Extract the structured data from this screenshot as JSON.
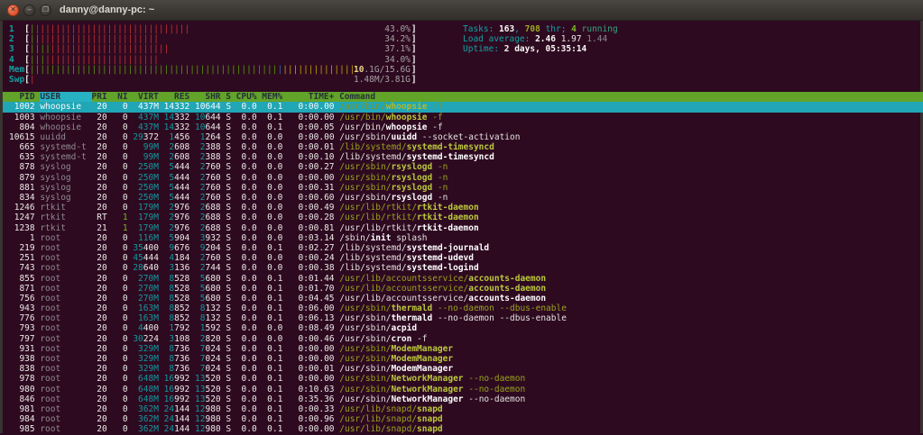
{
  "window": {
    "title": "danny@danny-pc: ~",
    "close_glyph": "✕",
    "minimize_glyph": "–",
    "maximize_glyph": "❐"
  },
  "colors": {
    "terminal_bg": "#2e0a21",
    "titlebar_bg": "#3a3733",
    "header_row_bg": "#62a32a",
    "selected_row_bg": "#21a6b6",
    "sort_column_bg": "#27b2c4",
    "label_cyan": "#12a1a1",
    "shadow_gray": "#8f8a90",
    "thread_command": "#99a31c",
    "bar_green": "#55980a",
    "bar_red": "#c53232",
    "bar_yellow": "#bfa000",
    "bar_blue": "#3566a4"
  },
  "meters": {
    "cpus": [
      {
        "label": "1",
        "pct": "43.0%",
        "green": 1,
        "red": 30
      },
      {
        "label": "2",
        "pct": "34.2%",
        "green": 2,
        "red": 23
      },
      {
        "label": "3",
        "pct": "37.1%",
        "green": 4,
        "red": 23
      },
      {
        "label": "4",
        "pct": "34.0%",
        "green": 3,
        "red": 22
      }
    ],
    "mem": {
      "label": "Mem",
      "green": 48,
      "blue": 1,
      "yellow": 14,
      "text_hl": "10",
      "text_rest": ".1G/15.6G"
    },
    "swp": {
      "label": "Swp",
      "red": 1,
      "text": "1.48M/3.81G"
    }
  },
  "info": {
    "tasks_label": "Tasks: ",
    "tasks_count": "163",
    "tasks_sep": ", ",
    "threads_count": "708",
    "threads_label": " thr; ",
    "running_count": "4",
    "running_label": " running",
    "load_label": "Load average: ",
    "load_1": "2.46 ",
    "load_2": "1.97 ",
    "load_3": "1.44",
    "uptime_label": "Uptime: ",
    "uptime_value": "2 days, 05:35:14"
  },
  "table": {
    "columns": [
      "PID",
      "USER",
      "PRI",
      "NI",
      "VIRT",
      "RES",
      "SHR",
      "S",
      "CPU%",
      "MEM%",
      "TIME+",
      "Command"
    ],
    "sort_column": "USER",
    "rows": [
      {
        "pid": "1002",
        "user": "whoopsie",
        "pri": "20",
        "ni": "0",
        "virt": "437M",
        "res": "14332",
        "shr": "10644",
        "s": "S",
        "cpu": "0.0",
        "mem": "0.1",
        "time": "0:00.00",
        "cmd": "/usr/bin/whoopsie -f",
        "thread": true,
        "selected": true
      },
      {
        "pid": "1003",
        "user": "whoopsie",
        "pri": "20",
        "ni": "0",
        "virt": "437M",
        "res": "14332",
        "shr": "10644",
        "s": "S",
        "cpu": "0.0",
        "mem": "0.1",
        "time": "0:00.00",
        "cmd": "/usr/bin/whoopsie -f",
        "thread": true,
        "selected": false
      },
      {
        "pid": "804",
        "user": "whoopsie",
        "pri": "20",
        "ni": "0",
        "virt": "437M",
        "res": "14332",
        "shr": "10644",
        "s": "S",
        "cpu": "0.0",
        "mem": "0.1",
        "time": "0:00.05",
        "cmd": "/usr/bin/whoopsie -f",
        "thread": false,
        "selected": false
      },
      {
        "pid": "10615",
        "user": "uuidd",
        "pri": "20",
        "ni": "0",
        "virt": "29372",
        "res": "1456",
        "shr": "1264",
        "s": "S",
        "cpu": "0.0",
        "mem": "0.0",
        "time": "0:00.00",
        "cmd": "/usr/sbin/uuidd --socket-activation",
        "thread": false,
        "selected": false
      },
      {
        "pid": "665",
        "user": "systemd-t",
        "pri": "20",
        "ni": "0",
        "virt": "99M",
        "res": "2608",
        "shr": "2388",
        "s": "S",
        "cpu": "0.0",
        "mem": "0.0",
        "time": "0:00.01",
        "cmd": "/lib/systemd/systemd-timesyncd",
        "thread": true,
        "selected": false
      },
      {
        "pid": "635",
        "user": "systemd-t",
        "pri": "20",
        "ni": "0",
        "virt": "99M",
        "res": "2608",
        "shr": "2388",
        "s": "S",
        "cpu": "0.0",
        "mem": "0.0",
        "time": "0:00.10",
        "cmd": "/lib/systemd/systemd-timesyncd",
        "thread": false,
        "selected": false
      },
      {
        "pid": "878",
        "user": "syslog",
        "pri": "20",
        "ni": "0",
        "virt": "250M",
        "res": "5444",
        "shr": "2760",
        "s": "S",
        "cpu": "0.0",
        "mem": "0.0",
        "time": "0:00.27",
        "cmd": "/usr/sbin/rsyslogd -n",
        "thread": true,
        "selected": false
      },
      {
        "pid": "879",
        "user": "syslog",
        "pri": "20",
        "ni": "0",
        "virt": "250M",
        "res": "5444",
        "shr": "2760",
        "s": "S",
        "cpu": "0.0",
        "mem": "0.0",
        "time": "0:00.00",
        "cmd": "/usr/sbin/rsyslogd -n",
        "thread": true,
        "selected": false
      },
      {
        "pid": "881",
        "user": "syslog",
        "pri": "20",
        "ni": "0",
        "virt": "250M",
        "res": "5444",
        "shr": "2760",
        "s": "S",
        "cpu": "0.0",
        "mem": "0.0",
        "time": "0:00.31",
        "cmd": "/usr/sbin/rsyslogd -n",
        "thread": true,
        "selected": false
      },
      {
        "pid": "834",
        "user": "syslog",
        "pri": "20",
        "ni": "0",
        "virt": "250M",
        "res": "5444",
        "shr": "2760",
        "s": "S",
        "cpu": "0.0",
        "mem": "0.0",
        "time": "0:00.60",
        "cmd": "/usr/sbin/rsyslogd -n",
        "thread": false,
        "selected": false
      },
      {
        "pid": "1246",
        "user": "rtkit",
        "pri": "20",
        "ni": "0",
        "virt": "179M",
        "res": "2976",
        "shr": "2688",
        "s": "S",
        "cpu": "0.0",
        "mem": "0.0",
        "time": "0:00.49",
        "cmd": "/usr/lib/rtkit/rtkit-daemon",
        "thread": true,
        "selected": false
      },
      {
        "pid": "1247",
        "user": "rtkit",
        "pri": "RT",
        "ni": "1",
        "virt": "179M",
        "res": "2976",
        "shr": "2688",
        "s": "S",
        "cpu": "0.0",
        "mem": "0.0",
        "time": "0:00.28",
        "cmd": "/usr/lib/rtkit/rtkit-daemon",
        "thread": true,
        "selected": false
      },
      {
        "pid": "1238",
        "user": "rtkit",
        "pri": "21",
        "ni": "1",
        "virt": "179M",
        "res": "2976",
        "shr": "2688",
        "s": "S",
        "cpu": "0.0",
        "mem": "0.0",
        "time": "0:00.81",
        "cmd": "/usr/lib/rtkit/rtkit-daemon",
        "thread": false,
        "selected": false
      },
      {
        "pid": "1",
        "user": "root",
        "pri": "20",
        "ni": "0",
        "virt": "116M",
        "res": "5904",
        "shr": "3932",
        "s": "S",
        "cpu": "0.0",
        "mem": "0.0",
        "time": "0:03.14",
        "cmd": "/sbin/init splash",
        "thread": false,
        "selected": false
      },
      {
        "pid": "219",
        "user": "root",
        "pri": "20",
        "ni": "0",
        "virt": "35400",
        "res": "9676",
        "shr": "9204",
        "s": "S",
        "cpu": "0.0",
        "mem": "0.1",
        "time": "0:02.27",
        "cmd": "/lib/systemd/systemd-journald",
        "thread": false,
        "selected": false
      },
      {
        "pid": "251",
        "user": "root",
        "pri": "20",
        "ni": "0",
        "virt": "45444",
        "res": "4184",
        "shr": "2760",
        "s": "S",
        "cpu": "0.0",
        "mem": "0.0",
        "time": "0:00.24",
        "cmd": "/lib/systemd/systemd-udevd",
        "thread": false,
        "selected": false
      },
      {
        "pid": "743",
        "user": "root",
        "pri": "20",
        "ni": "0",
        "virt": "28640",
        "res": "3136",
        "shr": "2744",
        "s": "S",
        "cpu": "0.0",
        "mem": "0.0",
        "time": "0:00.38",
        "cmd": "/lib/systemd/systemd-logind",
        "thread": false,
        "selected": false
      },
      {
        "pid": "855",
        "user": "root",
        "pri": "20",
        "ni": "0",
        "virt": "270M",
        "res": "8528",
        "shr": "5680",
        "s": "S",
        "cpu": "0.0",
        "mem": "0.1",
        "time": "0:01.44",
        "cmd": "/usr/lib/accountsservice/accounts-daemon",
        "thread": true,
        "selected": false
      },
      {
        "pid": "871",
        "user": "root",
        "pri": "20",
        "ni": "0",
        "virt": "270M",
        "res": "8528",
        "shr": "5680",
        "s": "S",
        "cpu": "0.0",
        "mem": "0.1",
        "time": "0:01.70",
        "cmd": "/usr/lib/accountsservice/accounts-daemon",
        "thread": true,
        "selected": false
      },
      {
        "pid": "756",
        "user": "root",
        "pri": "20",
        "ni": "0",
        "virt": "270M",
        "res": "8528",
        "shr": "5680",
        "s": "S",
        "cpu": "0.0",
        "mem": "0.1",
        "time": "0:04.45",
        "cmd": "/usr/lib/accountsservice/accounts-daemon",
        "thread": false,
        "selected": false
      },
      {
        "pid": "943",
        "user": "root",
        "pri": "20",
        "ni": "0",
        "virt": "163M",
        "res": "8852",
        "shr": "8132",
        "s": "S",
        "cpu": "0.0",
        "mem": "0.1",
        "time": "0:06.00",
        "cmd": "/usr/sbin/thermald --no-daemon --dbus-enable",
        "thread": true,
        "selected": false
      },
      {
        "pid": "776",
        "user": "root",
        "pri": "20",
        "ni": "0",
        "virt": "163M",
        "res": "8852",
        "shr": "8132",
        "s": "S",
        "cpu": "0.0",
        "mem": "0.1",
        "time": "0:06.13",
        "cmd": "/usr/sbin/thermald --no-daemon --dbus-enable",
        "thread": false,
        "selected": false
      },
      {
        "pid": "793",
        "user": "root",
        "pri": "20",
        "ni": "0",
        "virt": "4400",
        "res": "1792",
        "shr": "1592",
        "s": "S",
        "cpu": "0.0",
        "mem": "0.0",
        "time": "0:08.49",
        "cmd": "/usr/sbin/acpid",
        "thread": false,
        "selected": false
      },
      {
        "pid": "797",
        "user": "root",
        "pri": "20",
        "ni": "0",
        "virt": "30224",
        "res": "3108",
        "shr": "2820",
        "s": "S",
        "cpu": "0.0",
        "mem": "0.0",
        "time": "0:00.46",
        "cmd": "/usr/sbin/cron -f",
        "thread": false,
        "selected": false
      },
      {
        "pid": "931",
        "user": "root",
        "pri": "20",
        "ni": "0",
        "virt": "329M",
        "res": "8736",
        "shr": "7024",
        "s": "S",
        "cpu": "0.0",
        "mem": "0.1",
        "time": "0:00.00",
        "cmd": "/usr/sbin/ModemManager",
        "thread": true,
        "selected": false
      },
      {
        "pid": "938",
        "user": "root",
        "pri": "20",
        "ni": "0",
        "virt": "329M",
        "res": "8736",
        "shr": "7024",
        "s": "S",
        "cpu": "0.0",
        "mem": "0.1",
        "time": "0:00.00",
        "cmd": "/usr/sbin/ModemManager",
        "thread": true,
        "selected": false
      },
      {
        "pid": "838",
        "user": "root",
        "pri": "20",
        "ni": "0",
        "virt": "329M",
        "res": "8736",
        "shr": "7024",
        "s": "S",
        "cpu": "0.0",
        "mem": "0.1",
        "time": "0:00.01",
        "cmd": "/usr/sbin/ModemManager",
        "thread": false,
        "selected": false
      },
      {
        "pid": "978",
        "user": "root",
        "pri": "20",
        "ni": "0",
        "virt": "648M",
        "res": "16992",
        "shr": "13520",
        "s": "S",
        "cpu": "0.0",
        "mem": "0.1",
        "time": "0:00.00",
        "cmd": "/usr/sbin/NetworkManager --no-daemon",
        "thread": true,
        "selected": false
      },
      {
        "pid": "980",
        "user": "root",
        "pri": "20",
        "ni": "0",
        "virt": "648M",
        "res": "16992",
        "shr": "13520",
        "s": "S",
        "cpu": "0.0",
        "mem": "0.1",
        "time": "0:10.63",
        "cmd": "/usr/sbin/NetworkManager --no-daemon",
        "thread": true,
        "selected": false
      },
      {
        "pid": "846",
        "user": "root",
        "pri": "20",
        "ni": "0",
        "virt": "648M",
        "res": "16992",
        "shr": "13520",
        "s": "S",
        "cpu": "0.0",
        "mem": "0.1",
        "time": "0:35.36",
        "cmd": "/usr/sbin/NetworkManager --no-daemon",
        "thread": false,
        "selected": false
      },
      {
        "pid": "981",
        "user": "root",
        "pri": "20",
        "ni": "0",
        "virt": "362M",
        "res": "24144",
        "shr": "12980",
        "s": "S",
        "cpu": "0.0",
        "mem": "0.1",
        "time": "0:00.33",
        "cmd": "/usr/lib/snapd/snapd",
        "thread": true,
        "selected": false
      },
      {
        "pid": "984",
        "user": "root",
        "pri": "20",
        "ni": "0",
        "virt": "362M",
        "res": "24144",
        "shr": "12980",
        "s": "S",
        "cpu": "0.0",
        "mem": "0.1",
        "time": "0:00.96",
        "cmd": "/usr/lib/snapd/snapd",
        "thread": true,
        "selected": false
      },
      {
        "pid": "985",
        "user": "root",
        "pri": "20",
        "ni": "0",
        "virt": "362M",
        "res": "24144",
        "shr": "12980",
        "s": "S",
        "cpu": "0.0",
        "mem": "0.1",
        "time": "0:00.00",
        "cmd": "/usr/lib/snapd/snapd",
        "thread": true,
        "selected": false
      }
    ]
  }
}
